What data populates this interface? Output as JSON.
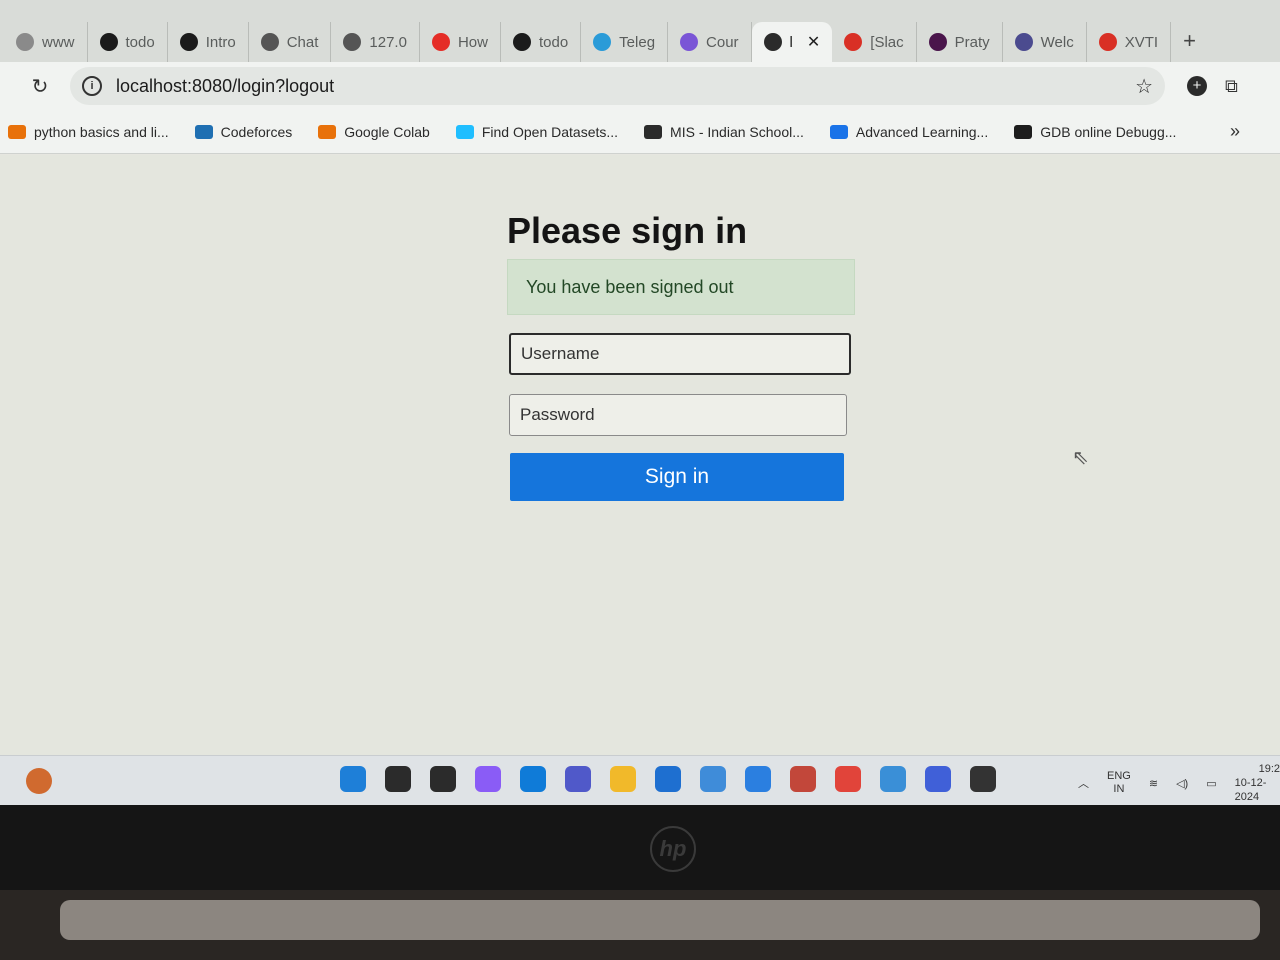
{
  "browser": {
    "tabs": [
      {
        "label": "www",
        "favicon_color": "#8a8a8a"
      },
      {
        "label": "todo",
        "favicon_color": "#1b1b1b"
      },
      {
        "label": "Intro",
        "favicon_color": "#1b1b1b"
      },
      {
        "label": "Chat",
        "favicon_color": "#555555"
      },
      {
        "label": "127.0",
        "favicon_color": "#555555"
      },
      {
        "label": "How",
        "favicon_color": "#e52d27"
      },
      {
        "label": "todo",
        "favicon_color": "#1b1b1b"
      },
      {
        "label": "Teleg",
        "favicon_color": "#2a9bd8"
      },
      {
        "label": "Cour",
        "favicon_color": "#7a55d6"
      },
      {
        "label": "l",
        "favicon_color": "#2b2b2b",
        "active": true
      },
      {
        "label": "[Slac",
        "favicon_color": "#d93025"
      },
      {
        "label": "Praty",
        "favicon_color": "#4a154b"
      },
      {
        "label": "Welc",
        "favicon_color": "#4b4b8f"
      },
      {
        "label": "XVTI",
        "favicon_color": "#d93025"
      }
    ],
    "new_tab_label": "+",
    "close_glyph": "✕",
    "url": "localhost:8080/login?logout",
    "bookmarks": [
      {
        "label": "python basics and li...",
        "icon_color": "#e8710a"
      },
      {
        "label": "Codeforces",
        "icon_color": "#1f6fb2"
      },
      {
        "label": "Google Colab",
        "icon_color": "#e8710a"
      },
      {
        "label": "Find Open Datasets...",
        "icon_color": "#20beff"
      },
      {
        "label": "MIS - Indian School...",
        "icon_color": "#2b2b2b"
      },
      {
        "label": "Advanced Learning...",
        "icon_color": "#1a73e8"
      },
      {
        "label": "GDB online Debugg...",
        "icon_color": "#1d1d1d"
      }
    ],
    "more_bookmarks_glyph": "»"
  },
  "login": {
    "title": "Please sign in",
    "alert": "You have been signed out",
    "username_placeholder": "Username",
    "password_placeholder": "Password",
    "submit_label": "Sign in",
    "accent_color": "#1575dc",
    "alert_color": "#d3e2cf"
  },
  "taskbar": {
    "app_icon_colors": [
      "#1e7fd8",
      "#2b2b2b",
      "#2b2b2b",
      "#8a5cf6",
      "#0f7bd8",
      "#5059c9",
      "#f1b92a",
      "#1e6fd0",
      "#3f8cd9",
      "#2b7fe0",
      "#c2473a",
      "#e1443a",
      "#3a8fd7",
      "#4060d8",
      "#333333"
    ],
    "language": "ENG",
    "region": "IN",
    "time": "19:2",
    "date": "10-12-2024"
  },
  "bezel": {
    "brand": "hp"
  }
}
